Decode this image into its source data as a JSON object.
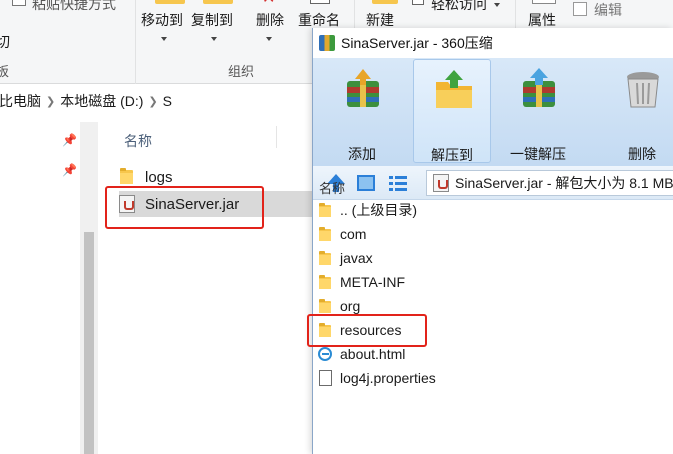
{
  "explorer": {
    "ribbon": {
      "paste_shortcut_label": "粘贴快捷方式",
      "move_to_label": "移动到",
      "copy_to_label": "复制到",
      "delete_label": "删除",
      "rename_label": "重命名",
      "new_label": "新建",
      "easy_access_label": "轻松访问",
      "properties_label": "属性",
      "edit_label": "编辑",
      "left_cut_text_1": "切",
      "left_cut_text_2": "板",
      "organize_group_label": "组织"
    },
    "breadcrumb": [
      "比电脑",
      "本地磁盘 (D:)",
      "S"
    ],
    "file_column_header": "名称",
    "files": [
      {
        "name": "logs",
        "icon": "folder-icon"
      },
      {
        "name": "SinaServer.jar",
        "icon": "jar-file-icon"
      }
    ]
  },
  "zip_window": {
    "title": "SinaServer.jar - 360压缩",
    "toolbar": [
      {
        "label": "添加",
        "icon": "add-archive-icon"
      },
      {
        "label": "解压到",
        "icon": "extract-to-icon"
      },
      {
        "label": "一键解压",
        "icon": "one-click-extract-icon"
      },
      {
        "label": "删除",
        "icon": "delete-bin-icon"
      }
    ],
    "path_text": "SinaServer.jar - 解包大小为 8.1 MB",
    "column_header": "名称",
    "entries": [
      {
        "name": ".. (上级目录)",
        "icon": "folder-icon"
      },
      {
        "name": "com",
        "icon": "folder-icon"
      },
      {
        "name": "javax",
        "icon": "folder-icon"
      },
      {
        "name": "META-INF",
        "icon": "folder-icon"
      },
      {
        "name": "org",
        "icon": "folder-icon"
      },
      {
        "name": "resources",
        "icon": "folder-icon"
      },
      {
        "name": "about.html",
        "icon": "html-file-icon"
      },
      {
        "name": "log4j.properties",
        "icon": "text-file-icon"
      }
    ]
  },
  "colors": {
    "highlight_red": "#e2231a",
    "toolbar_blue": "#c3daf2",
    "selected_gray": "#d9d9d9",
    "folder_yellow": "#ffd76a"
  }
}
